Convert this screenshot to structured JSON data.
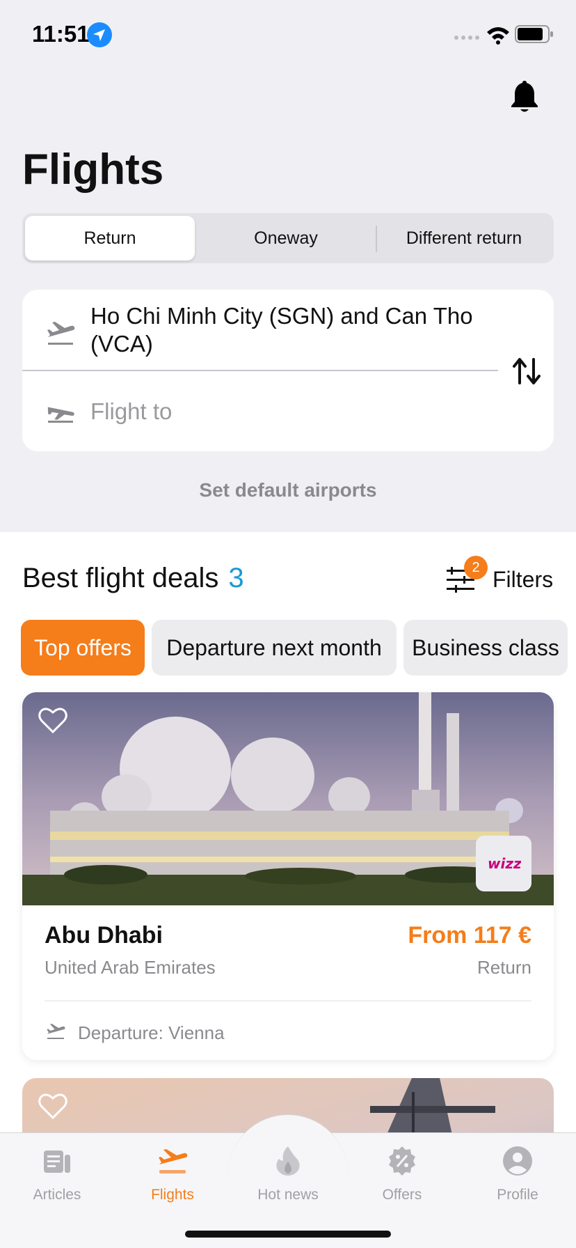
{
  "status_bar": {
    "time": "11:51"
  },
  "page": {
    "title": "Flights"
  },
  "trip_type": {
    "options": [
      "Return",
      "Oneway",
      "Different return"
    ],
    "selected": "Return"
  },
  "search": {
    "from_value": "Ho Chi Minh City (SGN) and Can Tho (VCA)",
    "to_placeholder": "Flight to",
    "default_airports_label": "Set default airports"
  },
  "deals": {
    "title": "Best flight deals",
    "count": "3",
    "filters_label": "Filters",
    "filters_badge": "2",
    "chips": [
      "Top offers",
      "Departure next month",
      "Business class"
    ],
    "items": [
      {
        "city": "Abu Dhabi",
        "country": "United Arab Emirates",
        "price": "From 117 €",
        "trip": "Return",
        "departure": "Departure: Vienna",
        "airline": "wizz"
      }
    ]
  },
  "tabs": [
    {
      "label": "Articles",
      "icon": "articles-icon"
    },
    {
      "label": "Flights",
      "icon": "airplane-icon"
    },
    {
      "label": "Hot news",
      "icon": "flame-icon"
    },
    {
      "label": "Offers",
      "icon": "percent-badge-icon"
    },
    {
      "label": "Profile",
      "icon": "person-icon"
    }
  ],
  "colors": {
    "accent": "#f57d1a",
    "count": "#1a9ad6",
    "background": "#f0f0f4"
  }
}
